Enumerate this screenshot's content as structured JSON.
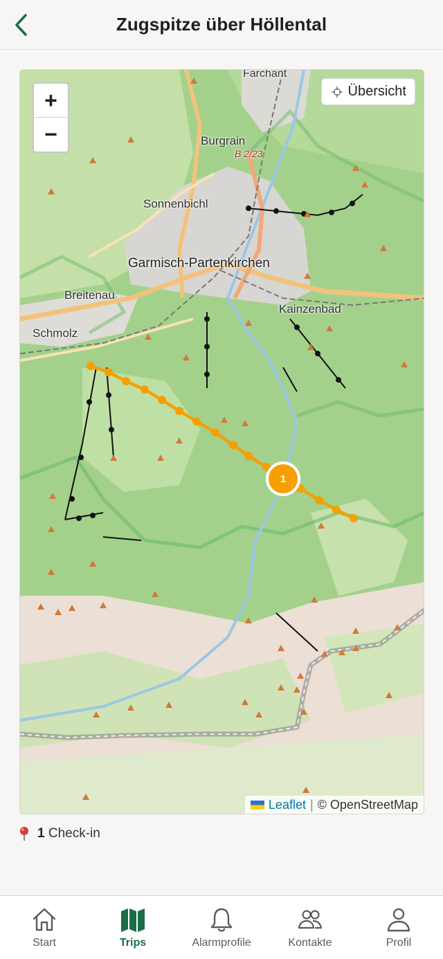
{
  "header": {
    "title": "Zugspitze über Höllental"
  },
  "map": {
    "zoom_in": "+",
    "zoom_out": "−",
    "overview_label": "Übersicht",
    "places": [
      "Farchant",
      "Burgrain",
      "B 2/23",
      "Sonnenbichl",
      "Garmisch-Partenkirchen",
      "Breitenau",
      "Kainzenbad",
      "Schmolz"
    ],
    "marker_count": "1",
    "attribution": {
      "leaflet": "Leaflet",
      "separator": "|",
      "osm": "© OpenStreetMap"
    },
    "colors": {
      "route": "#f5a000",
      "forest": "#9fcf87",
      "rock": "#ecdfd5",
      "town": "#d3d1cd"
    }
  },
  "checkin": {
    "count": "1",
    "label": "Check-in"
  },
  "tabbar": {
    "items": [
      {
        "label": "Start",
        "icon": "home-icon",
        "active": false
      },
      {
        "label": "Trips",
        "icon": "map-icon",
        "active": true
      },
      {
        "label": "Alarmprofile",
        "icon": "bell-icon",
        "active": false
      },
      {
        "label": "Kontakte",
        "icon": "contacts-icon",
        "active": false
      },
      {
        "label": "Profil",
        "icon": "person-icon",
        "active": false
      }
    ]
  }
}
